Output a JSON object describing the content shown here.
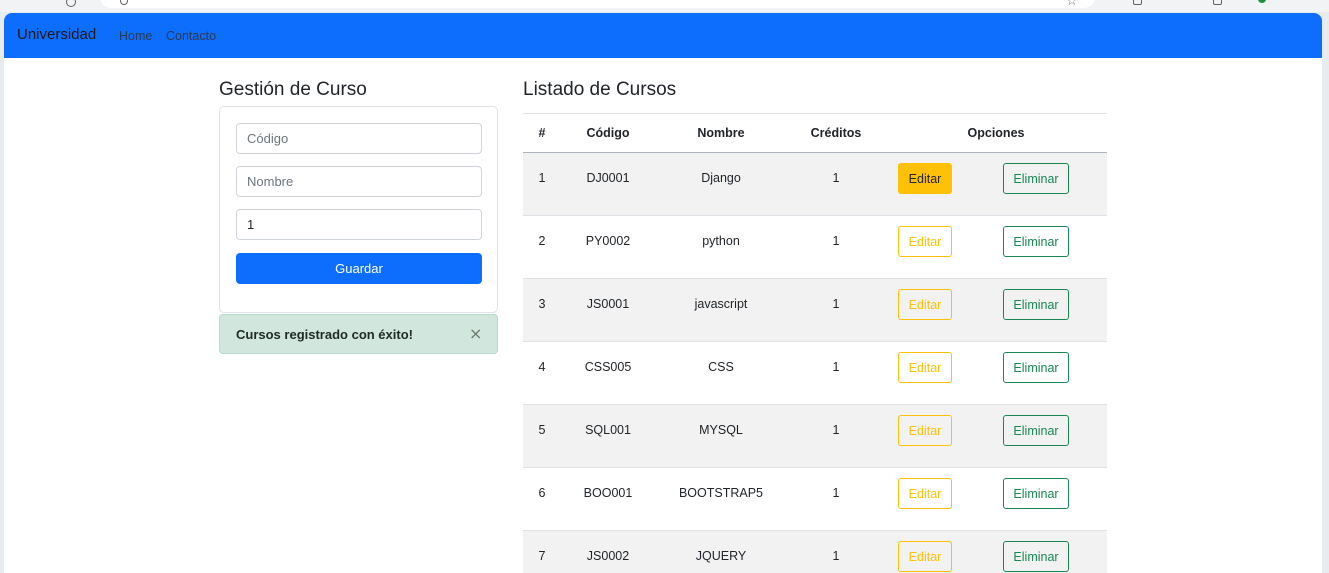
{
  "navbar": {
    "brand": "Universidad",
    "links": [
      {
        "label": "Home"
      },
      {
        "label": "Contacto"
      }
    ]
  },
  "form": {
    "title": "Gestión de Curso",
    "codigo_placeholder": "Código",
    "nombre_placeholder": "Nombre",
    "creditos_value": "1",
    "save_label": "Guardar"
  },
  "alert": {
    "message": "Cursos registrado con éxito!",
    "close_glyph": "×"
  },
  "list": {
    "title": "Listado de Cursos",
    "columns": [
      "#",
      "Código",
      "Nombre",
      "Créditos",
      "Opciones"
    ],
    "edit_label": "Editar",
    "delete_label": "Eliminar",
    "rows": [
      {
        "num": "1",
        "codigo": "DJ0001",
        "nombre": "Django",
        "creditos": "1"
      },
      {
        "num": "2",
        "codigo": "PY0002",
        "nombre": "python",
        "creditos": "1"
      },
      {
        "num": "3",
        "codigo": "JS0001",
        "nombre": "javascript",
        "creditos": "1"
      },
      {
        "num": "4",
        "codigo": "CSS005",
        "nombre": "CSS",
        "creditos": "1"
      },
      {
        "num": "5",
        "codigo": "SQL001",
        "nombre": "MYSQL",
        "creditos": "1"
      },
      {
        "num": "6",
        "codigo": "BOO001",
        "nombre": "BOOTSTRAP5",
        "creditos": "1"
      },
      {
        "num": "7",
        "codigo": "JS0002",
        "nombre": "JQUERY",
        "creditos": "1"
      }
    ]
  },
  "colors": {
    "primary": "#0d6efd",
    "warning": "#ffc107",
    "success": "#198754",
    "alert_bg": "#d1e7dd"
  },
  "icons": {
    "alert_close": "close-icon",
    "browser_star": "star-icon"
  }
}
